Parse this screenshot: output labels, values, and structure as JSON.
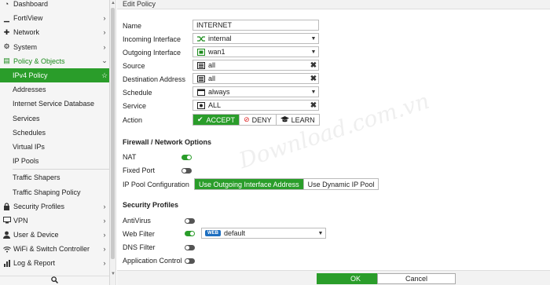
{
  "sidebar": {
    "items": [
      {
        "label": "Dashboard",
        "icon": "dashboard-icon",
        "glyph": "◔",
        "chev": ""
      },
      {
        "label": "FortiView",
        "icon": "chart-icon",
        "glyph": "▁",
        "chev": "›"
      },
      {
        "label": "Network",
        "icon": "network-icon",
        "glyph": "✚",
        "chev": "›"
      },
      {
        "label": "System",
        "icon": "gear-icon",
        "glyph": "⚙",
        "chev": "›"
      },
      {
        "label": "Policy & Objects",
        "icon": "policy-icon",
        "glyph": "▤",
        "chev": "⌄"
      },
      {
        "label": "IPv4 Policy",
        "chev": "☆"
      },
      {
        "label": "Addresses"
      },
      {
        "label": "Internet Service Database"
      },
      {
        "label": "Services"
      },
      {
        "label": "Schedules"
      },
      {
        "label": "Virtual IPs"
      },
      {
        "label": "IP Pools"
      },
      {
        "label": "Traffic Shapers"
      },
      {
        "label": "Traffic Shaping Policy"
      },
      {
        "label": "Security Profiles",
        "icon": "lock-icon",
        "glyph": "🔒",
        "chev": "›"
      },
      {
        "label": "VPN",
        "icon": "monitor-icon",
        "glyph": "▭",
        "chev": "›"
      },
      {
        "label": "User & Device",
        "icon": "user-icon",
        "glyph": "●",
        "chev": "›"
      },
      {
        "label": "WiFi & Switch Controller",
        "icon": "wifi-icon",
        "glyph": "◠",
        "chev": "›"
      },
      {
        "label": "Log & Report",
        "icon": "chart-icon",
        "glyph": "▦",
        "chev": "›"
      }
    ],
    "search_icon": "search-icon"
  },
  "page": {
    "title": "Edit Policy"
  },
  "form": {
    "name_label": "Name",
    "name_value": "INTERNET",
    "incoming_label": "Incoming Interface",
    "incoming_value": "internal",
    "outgoing_label": "Outgoing Interface",
    "outgoing_value": "wan1",
    "source_label": "Source",
    "source_value": "all",
    "dest_label": "Destination Address",
    "dest_value": "all",
    "schedule_label": "Schedule",
    "schedule_value": "always",
    "service_label": "Service",
    "service_value": "ALL",
    "action_label": "Action",
    "action_options": [
      "ACCEPT",
      "DENY",
      "LEARN"
    ],
    "action_selected": "ACCEPT"
  },
  "firewall": {
    "heading": "Firewall / Network Options",
    "nat_label": "NAT",
    "nat_on": true,
    "fixed_port_label": "Fixed Port",
    "fixed_port_on": false,
    "ippool_label": "IP Pool Configuration",
    "ippool_options": [
      "Use Outgoing Interface Address",
      "Use Dynamic IP Pool"
    ],
    "ippool_selected": "Use Outgoing Interface Address"
  },
  "security": {
    "heading": "Security Profiles",
    "antivirus_label": "AntiVirus",
    "antivirus_on": false,
    "webfilter_label": "Web Filter",
    "webfilter_on": true,
    "webfilter_badge": "WEB",
    "webfilter_value": "default",
    "dnsfilter_label": "DNS Filter",
    "dnsfilter_on": false,
    "appcontrol_label": "Application Control",
    "appcontrol_on": false
  },
  "footer": {
    "ok_label": "OK",
    "cancel_label": "Cancel"
  },
  "watermark": "Download.com.vn",
  "colors": {
    "accent": "#2a9d2a",
    "accent_text": "#1a8a1a"
  }
}
